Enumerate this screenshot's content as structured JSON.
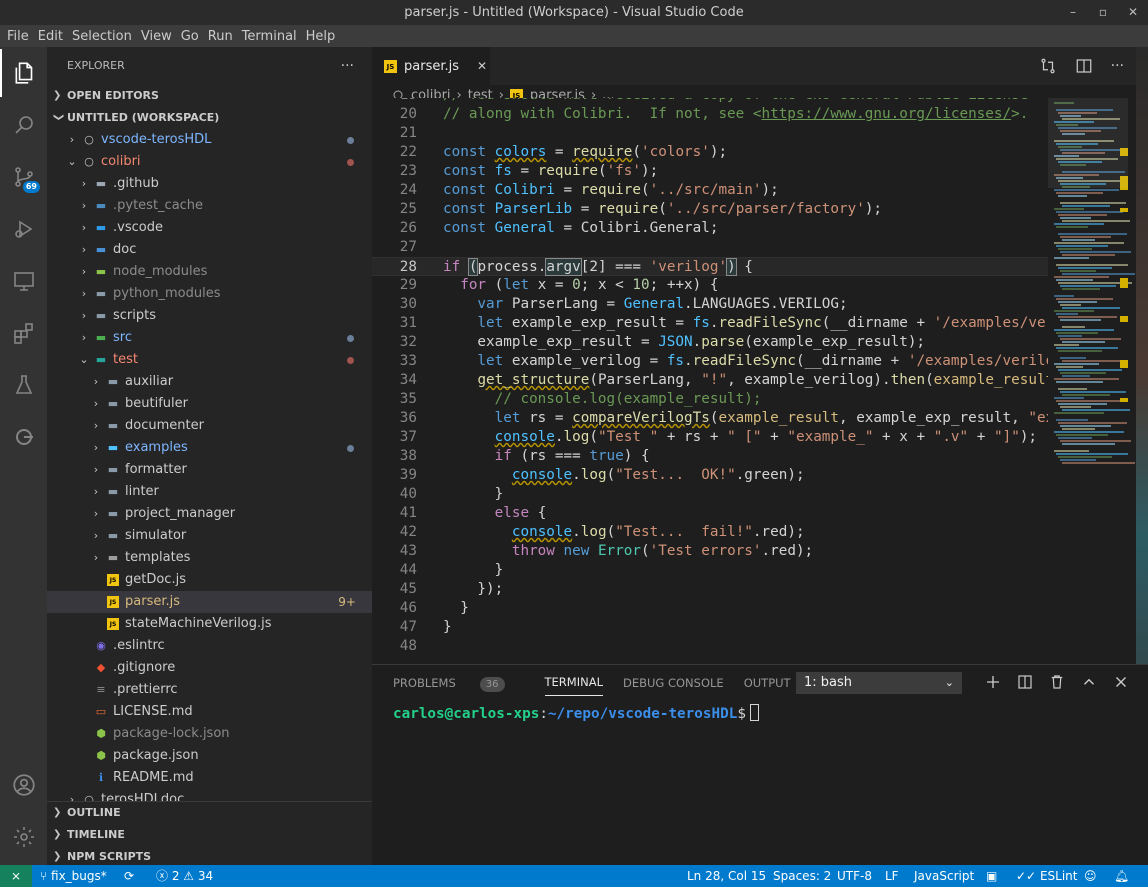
{
  "window": {
    "title": "parser.js - Untitled (Workspace) - Visual Studio Code",
    "controls": [
      "–",
      "▫",
      "✕"
    ]
  },
  "menu": [
    "File",
    "Edit",
    "Selection",
    "View",
    "Go",
    "Run",
    "Terminal",
    "Help"
  ],
  "activity": {
    "scm_badge": "69"
  },
  "sidebar": {
    "title": "EXPLORER",
    "more": "···",
    "open_editors": "OPEN EDITORS",
    "workspace": "UNTITLED (WORKSPACE)",
    "items": [
      {
        "label": "vscode-terosHDL",
        "indent": 0,
        "arrow": "›",
        "icon": "repo",
        "color": "#7eb6ff",
        "dot": "#6b7f99"
      },
      {
        "label": "colibri",
        "indent": 0,
        "arrow": "⌄",
        "icon": "repo",
        "color": "#f48771",
        "dot": "#a0544e"
      },
      {
        "label": ".github",
        "indent": 1,
        "arrow": "›",
        "icon": "folder-github",
        "color": "#cccccc"
      },
      {
        "label": ".pytest_cache",
        "indent": 1,
        "arrow": "›",
        "icon": "folder-python",
        "color": "#8b8b8b"
      },
      {
        "label": ".vscode",
        "indent": 1,
        "arrow": "›",
        "icon": "folder-vscode",
        "color": "#cccccc"
      },
      {
        "label": "doc",
        "indent": 1,
        "arrow": "›",
        "icon": "folder-doc",
        "color": "#cccccc"
      },
      {
        "label": "node_modules",
        "indent": 1,
        "arrow": "›",
        "icon": "folder-node",
        "color": "#8b8b8b"
      },
      {
        "label": "python_modules",
        "indent": 1,
        "arrow": "›",
        "icon": "folder",
        "color": "#8b8b8b"
      },
      {
        "label": "scripts",
        "indent": 1,
        "arrow": "›",
        "icon": "folder",
        "color": "#cccccc"
      },
      {
        "label": "src",
        "indent": 1,
        "arrow": "›",
        "icon": "folder-src",
        "color": "#7eb6ff",
        "dot": "#6b7f99"
      },
      {
        "label": "test",
        "indent": 1,
        "arrow": "⌄",
        "icon": "folder-test",
        "color": "#f48771",
        "dot": "#a0544e"
      },
      {
        "label": "auxiliar",
        "indent": 2,
        "arrow": "›",
        "icon": "folder",
        "color": "#cccccc"
      },
      {
        "label": "beutifuler",
        "indent": 2,
        "arrow": "›",
        "icon": "folder",
        "color": "#cccccc"
      },
      {
        "label": "documenter",
        "indent": 2,
        "arrow": "›",
        "icon": "folder",
        "color": "#cccccc"
      },
      {
        "label": "examples",
        "indent": 2,
        "arrow": "›",
        "icon": "folder-examples",
        "color": "#7eb6ff",
        "dot": "#6b7f99"
      },
      {
        "label": "formatter",
        "indent": 2,
        "arrow": "›",
        "icon": "folder",
        "color": "#cccccc"
      },
      {
        "label": "linter",
        "indent": 2,
        "arrow": "›",
        "icon": "folder",
        "color": "#cccccc"
      },
      {
        "label": "project_manager",
        "indent": 2,
        "arrow": "›",
        "icon": "folder",
        "color": "#cccccc"
      },
      {
        "label": "simulator",
        "indent": 2,
        "arrow": "›",
        "icon": "folder",
        "color": "#cccccc"
      },
      {
        "label": "templates",
        "indent": 2,
        "arrow": "›",
        "icon": "folder-templates",
        "color": "#cccccc"
      },
      {
        "label": "getDoc.js",
        "indent": 2,
        "arrow": "",
        "icon": "js",
        "color": "#cccccc"
      },
      {
        "label": "parser.js",
        "indent": 2,
        "arrow": "",
        "icon": "js",
        "color": "#d7ba7d",
        "selected": true,
        "count": "9+"
      },
      {
        "label": "stateMachineVerilog.js",
        "indent": 2,
        "arrow": "",
        "icon": "js",
        "color": "#cccccc"
      },
      {
        "label": ".eslintrc",
        "indent": 1,
        "arrow": "",
        "icon": "eslint",
        "color": "#cccccc"
      },
      {
        "label": ".gitignore",
        "indent": 1,
        "arrow": "",
        "icon": "git",
        "color": "#cccccc"
      },
      {
        "label": ".prettierrc",
        "indent": 1,
        "arrow": "",
        "icon": "prettier",
        "color": "#cccccc"
      },
      {
        "label": "LICENSE.md",
        "indent": 1,
        "arrow": "",
        "icon": "license",
        "color": "#cccccc"
      },
      {
        "label": "package-lock.json",
        "indent": 1,
        "arrow": "",
        "icon": "node",
        "color": "#8b8b8b"
      },
      {
        "label": "package.json",
        "indent": 1,
        "arrow": "",
        "icon": "node",
        "color": "#cccccc"
      },
      {
        "label": "README.md",
        "indent": 1,
        "arrow": "",
        "icon": "info",
        "color": "#cccccc"
      },
      {
        "label": "terosHDLdoc",
        "indent": 0,
        "arrow": "›",
        "icon": "repo",
        "color": "#cccccc"
      }
    ],
    "outline": "OUTLINE",
    "timeline": "TIMELINE",
    "npm": "NPM SCRIPTS"
  },
  "tab": {
    "label": "parser.js",
    "close": "✕"
  },
  "breadcrumb": [
    "colibri",
    "test",
    "parser.js",
    "..."
  ],
  "code": [
    {
      "n": "19",
      "t": [
        [
          "// You should have received a copy of the GNU General Public License",
          "#6a9955"
        ]
      ]
    },
    {
      "n": "20",
      "t": [
        [
          "// along with Colibri.  If not, see <",
          "#6a9955"
        ],
        [
          "https://www.gnu.org/licenses/",
          "#6a9955",
          "u"
        ],
        [
          ">.",
          "#6a9955"
        ]
      ]
    },
    {
      "n": "21",
      "t": []
    },
    {
      "n": "22",
      "t": [
        [
          "const ",
          "#569cd6"
        ],
        [
          "colors",
          "#4fc1ff",
          "w"
        ],
        [
          " = ",
          "#d4d4d4"
        ],
        [
          "require",
          "#dcdcaa",
          "w"
        ],
        [
          "(",
          "#d4d4d4"
        ],
        [
          "'colors'",
          "#ce9178"
        ],
        [
          ");",
          "#d4d4d4"
        ]
      ]
    },
    {
      "n": "23",
      "t": [
        [
          "const ",
          "#569cd6"
        ],
        [
          "fs",
          "#4fc1ff"
        ],
        [
          " = ",
          "#d4d4d4"
        ],
        [
          "require",
          "#dcdcaa"
        ],
        [
          "(",
          "#d4d4d4"
        ],
        [
          "'fs'",
          "#ce9178"
        ],
        [
          ");",
          "#d4d4d4"
        ]
      ]
    },
    {
      "n": "24",
      "t": [
        [
          "const ",
          "#569cd6"
        ],
        [
          "Colibri",
          "#4fc1ff"
        ],
        [
          " = ",
          "#d4d4d4"
        ],
        [
          "require",
          "#dcdcaa"
        ],
        [
          "(",
          "#d4d4d4"
        ],
        [
          "'../src/main'",
          "#ce9178"
        ],
        [
          ");",
          "#d4d4d4"
        ]
      ]
    },
    {
      "n": "25",
      "t": [
        [
          "const ",
          "#569cd6"
        ],
        [
          "ParserLib",
          "#4fc1ff"
        ],
        [
          " = ",
          "#d4d4d4"
        ],
        [
          "require",
          "#dcdcaa"
        ],
        [
          "(",
          "#d4d4d4"
        ],
        [
          "'../src/parser/factory'",
          "#ce9178"
        ],
        [
          ");",
          "#d4d4d4"
        ]
      ]
    },
    {
      "n": "26",
      "t": [
        [
          "const ",
          "#569cd6"
        ],
        [
          "General",
          "#4fc1ff"
        ],
        [
          " = Colibri.General;",
          "#d4d4d4"
        ]
      ]
    },
    {
      "n": "27",
      "t": []
    },
    {
      "n": "28",
      "t": [
        [
          "if ",
          "#c586c0"
        ],
        [
          "(",
          "#d4d4d4",
          "b"
        ],
        [
          "process.",
          "#d4d4d4"
        ],
        [
          "argv",
          "#d4d4d4",
          "b"
        ],
        [
          "[2] === ",
          "#d4d4d4"
        ],
        [
          "'verilog'",
          "#ce9178"
        ],
        [
          ")",
          "#d4d4d4",
          "b"
        ],
        [
          " {",
          "#d4d4d4"
        ]
      ],
      "active": true
    },
    {
      "n": "29",
      "t": [
        [
          "  for ",
          "#c586c0"
        ],
        [
          "(",
          "#d4d4d4"
        ],
        [
          "let ",
          "#569cd6"
        ],
        [
          "x = ",
          "#d4d4d4"
        ],
        [
          "0",
          "#b5cea8"
        ],
        [
          "; x < ",
          "#d4d4d4"
        ],
        [
          "10",
          "#b5cea8"
        ],
        [
          "; ++x) {",
          "#d4d4d4"
        ]
      ]
    },
    {
      "n": "30",
      "t": [
        [
          "    var ",
          "#569cd6"
        ],
        [
          "ParserLang = ",
          "#d4d4d4"
        ],
        [
          "General",
          "#4fc1ff"
        ],
        [
          ".LANGUAGES.VERILOG;",
          "#d4d4d4"
        ]
      ]
    },
    {
      "n": "31",
      "t": [
        [
          "    let ",
          "#569cd6"
        ],
        [
          "example_exp_result = ",
          "#d4d4d4"
        ],
        [
          "fs",
          "#4fc1ff"
        ],
        [
          ".",
          "#d4d4d4"
        ],
        [
          "readFileSync",
          "#dcdcaa"
        ],
        [
          "(__dirname + ",
          "#d4d4d4"
        ],
        [
          "'/examples/veri",
          "#ce9178"
        ]
      ]
    },
    {
      "n": "32",
      "t": [
        [
          "    example_exp_result = ",
          "#d4d4d4"
        ],
        [
          "JSON",
          "#4fc1ff"
        ],
        [
          ".",
          "#d4d4d4"
        ],
        [
          "parse",
          "#dcdcaa"
        ],
        [
          "(example_exp_result);",
          "#d4d4d4"
        ]
      ]
    },
    {
      "n": "33",
      "t": [
        [
          "    let ",
          "#569cd6"
        ],
        [
          "example_verilog = ",
          "#d4d4d4"
        ],
        [
          "fs",
          "#4fc1ff"
        ],
        [
          ".",
          "#d4d4d4"
        ],
        [
          "readFileSync",
          "#dcdcaa"
        ],
        [
          "(__dirname + ",
          "#d4d4d4"
        ],
        [
          "'/examples/verilog",
          "#ce9178"
        ]
      ]
    },
    {
      "n": "34",
      "t": [
        [
          "    ",
          "#d4d4d4"
        ],
        [
          "get_structure",
          "#dcdcaa",
          "w"
        ],
        [
          "(ParserLang, ",
          "#d4d4d4"
        ],
        [
          "\"!\"",
          "#ce9178"
        ],
        [
          ", example_verilog).",
          "#d4d4d4"
        ],
        [
          "then",
          "#dcdcaa"
        ],
        [
          "(",
          "#d4d4d4"
        ],
        [
          "example_result",
          "#d7ba7d"
        ]
      ]
    },
    {
      "n": "35",
      "t": [
        [
          "      // console.log(example_result);",
          "#6a9955"
        ]
      ]
    },
    {
      "n": "36",
      "t": [
        [
          "      let ",
          "#569cd6"
        ],
        [
          "rs = ",
          "#d4d4d4"
        ],
        [
          "compareVerilogTs",
          "#dcdcaa",
          "w"
        ],
        [
          "(",
          "#d4d4d4"
        ],
        [
          "example_result",
          "#d7ba7d"
        ],
        [
          ", example_exp_result, ",
          "#d4d4d4"
        ],
        [
          "\"exa",
          "#ce9178"
        ]
      ]
    },
    {
      "n": "37",
      "t": [
        [
          "      ",
          "#d4d4d4"
        ],
        [
          "console",
          "#4fc1ff",
          "w"
        ],
        [
          ".",
          "#d4d4d4"
        ],
        [
          "log",
          "#dcdcaa"
        ],
        [
          "(",
          "#d4d4d4"
        ],
        [
          "\"Test \"",
          "#ce9178"
        ],
        [
          " + rs + ",
          "#d4d4d4"
        ],
        [
          "\" [\"",
          "#ce9178"
        ],
        [
          " + ",
          "#d4d4d4"
        ],
        [
          "\"example_\"",
          "#ce9178"
        ],
        [
          " + x + ",
          "#d4d4d4"
        ],
        [
          "\".v\"",
          "#ce9178"
        ],
        [
          " + ",
          "#d4d4d4"
        ],
        [
          "\"]\"",
          "#ce9178"
        ],
        [
          ");",
          "#d4d4d4"
        ]
      ]
    },
    {
      "n": "38",
      "t": [
        [
          "      if ",
          "#c586c0"
        ],
        [
          "(rs === ",
          "#d4d4d4"
        ],
        [
          "true",
          "#569cd6"
        ],
        [
          ") {",
          "#d4d4d4"
        ]
      ]
    },
    {
      "n": "39",
      "t": [
        [
          "        ",
          "#d4d4d4"
        ],
        [
          "console",
          "#4fc1ff",
          "w"
        ],
        [
          ".",
          "#d4d4d4"
        ],
        [
          "log",
          "#dcdcaa"
        ],
        [
          "(",
          "#d4d4d4"
        ],
        [
          "\"Test...  OK!\"",
          "#ce9178"
        ],
        [
          ".green);",
          "#d4d4d4"
        ]
      ]
    },
    {
      "n": "40",
      "t": [
        [
          "      }",
          "#d4d4d4"
        ]
      ]
    },
    {
      "n": "41",
      "t": [
        [
          "      else ",
          "#c586c0"
        ],
        [
          "{",
          "#d4d4d4"
        ]
      ]
    },
    {
      "n": "42",
      "t": [
        [
          "        ",
          "#d4d4d4"
        ],
        [
          "console",
          "#4fc1ff",
          "w"
        ],
        [
          ".",
          "#d4d4d4"
        ],
        [
          "log",
          "#dcdcaa"
        ],
        [
          "(",
          "#d4d4d4"
        ],
        [
          "\"Test...  fail!\"",
          "#ce9178"
        ],
        [
          ".red);",
          "#d4d4d4"
        ]
      ]
    },
    {
      "n": "43",
      "t": [
        [
          "        throw ",
          "#c586c0"
        ],
        [
          "new ",
          "#569cd6"
        ],
        [
          "Error",
          "#4ec9b0"
        ],
        [
          "(",
          "#d4d4d4"
        ],
        [
          "'Test errors'",
          "#ce9178"
        ],
        [
          ".red);",
          "#d4d4d4"
        ]
      ]
    },
    {
      "n": "44",
      "t": [
        [
          "      }",
          "#d4d4d4"
        ]
      ]
    },
    {
      "n": "45",
      "t": [
        [
          "    });",
          "#d4d4d4"
        ]
      ]
    },
    {
      "n": "46",
      "t": [
        [
          "  }",
          "#d4d4d4"
        ]
      ]
    },
    {
      "n": "47",
      "t": [
        [
          "}",
          "#d4d4d4"
        ]
      ]
    },
    {
      "n": "48",
      "t": []
    }
  ],
  "panel": {
    "tabs": [
      "PROBLEMS",
      "TERMINAL",
      "DEBUG CONSOLE",
      "OUTPUT"
    ],
    "problems_count": "36",
    "active_tab": "TERMINAL",
    "terminal_select": "1: bash",
    "prompt_user": "carlos@carlos-xps",
    "prompt_path": "~/repo/vscode-terosHDL",
    "prompt_symbol": "$"
  },
  "status": {
    "branch": "fix_bugs*",
    "errors": "2",
    "warnings": "34",
    "position": "Ln 28, Col 15",
    "spaces": "Spaces: 2",
    "encoding": "UTF-8",
    "eol": "LF",
    "language": "JavaScript",
    "eslint": "ESLint"
  },
  "colors": {
    "accent": "#007acc",
    "selection": "#37373d"
  }
}
